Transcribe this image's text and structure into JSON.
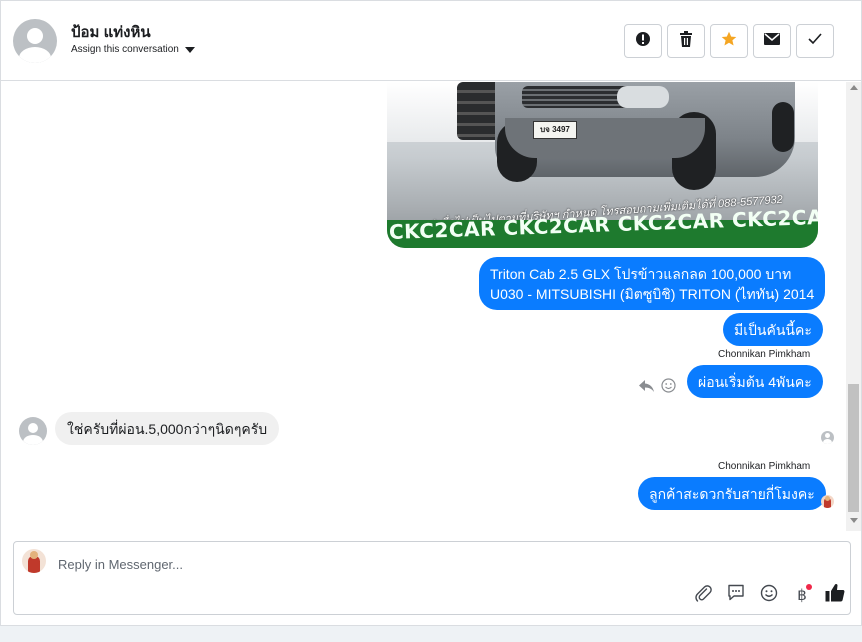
{
  "header": {
    "contact_name": "ป้อม แท่งหิน",
    "assign_label": "Assign this conversation",
    "actions": [
      "spam-icon",
      "trash-icon",
      "star-icon",
      "mail-icon",
      "check-icon"
    ],
    "accent_star": "#f5a623"
  },
  "conversation": {
    "image": {
      "plate": "บจ 3497",
      "slogan": "*เมื่อไปเป็นไปตามที่บริษัทฯ กำหนด โทรสอบถามเพิ่มเติมได้ที่ 088-5577932",
      "banner": "CKC2CAR CKC2CAR CKC2CAR CKC2CAR CKC2CAR CKC2"
    },
    "outgoing": [
      {
        "line1": "Triton Cab 2.5 GLX โปรข้าวแลกลด 100,000 บาท",
        "line2": "U030 - MITSUBISHI (มิตซูบิชิ) TRITON (ไททัน) 2014"
      },
      {
        "text": "มีเป็นคันนี้คะ"
      },
      {
        "sender": "Chonnikan Pimkham",
        "text": "ผ่อนเริ่มต้น 4พันคะ"
      },
      {
        "sender": "Chonnikan Pimkham",
        "text": "ลูกค้าสะดวกรับสายกี่โมงคะ"
      }
    ],
    "incoming": [
      {
        "text": "ใช่ครับที่ผ่อน.5,000กว่าๆนิดๆครับ"
      }
    ],
    "bubble_color": "#0a7cff"
  },
  "reply": {
    "placeholder": "Reply in Messenger...",
    "tools": [
      "attach-icon",
      "saved-reply-icon",
      "emoji-icon",
      "baht-icon",
      "like-icon"
    ],
    "baht_symbol": "฿"
  }
}
